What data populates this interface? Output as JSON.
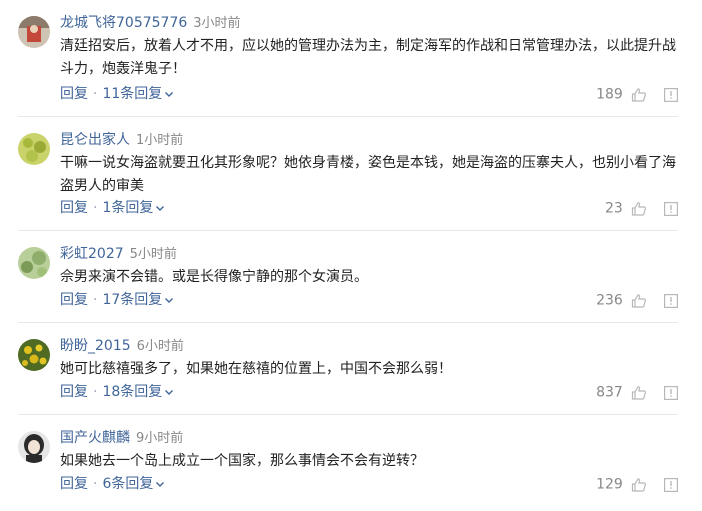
{
  "comments": [
    {
      "user": "龙城飞将70575776",
      "time": "3小时前",
      "text": "清廷招安后，放着人才不用，应以她的管理办法为主，制定海军的作战和日常管理办法，以此提升战斗力，炮轰洋鬼子！",
      "reply_label": "回复",
      "replies_label": "11条回复",
      "likes": "189",
      "avatar_color": "#8c7a6a"
    },
    {
      "user": "昆仑出家人",
      "time": "1小时前",
      "text": "干嘛一说女海盗就要丑化其形象呢？她依身青楼，姿色是本钱，她是海盗的压寨夫人，也别小看了海盗男人的审美",
      "reply_label": "回复",
      "replies_label": "1条回复",
      "likes": "23",
      "avatar_color": "#b7c44a"
    },
    {
      "user": "彩虹2027",
      "time": "5小时前",
      "text": "佘男来演不会错。或是长得像宁静的那个女演员。",
      "reply_label": "回复",
      "replies_label": "17条回复",
      "likes": "236",
      "avatar_color": "#8fae6b"
    },
    {
      "user": "盼盼_2015",
      "time": "6小时前",
      "text": "她可比慈禧强多了，如果她在慈禧的位置上，中国不会那么弱！",
      "reply_label": "回复",
      "replies_label": "18条回复",
      "likes": "837",
      "avatar_color": "#6f8a2e"
    },
    {
      "user": "国产火麒麟",
      "time": "9小时前",
      "text": "如果她去一个岛上成立一个国家，那么事情会不会有逆转？",
      "reply_label": "回复",
      "replies_label": "6条回复",
      "likes": "129",
      "avatar_color": "#3a3a3a"
    }
  ]
}
